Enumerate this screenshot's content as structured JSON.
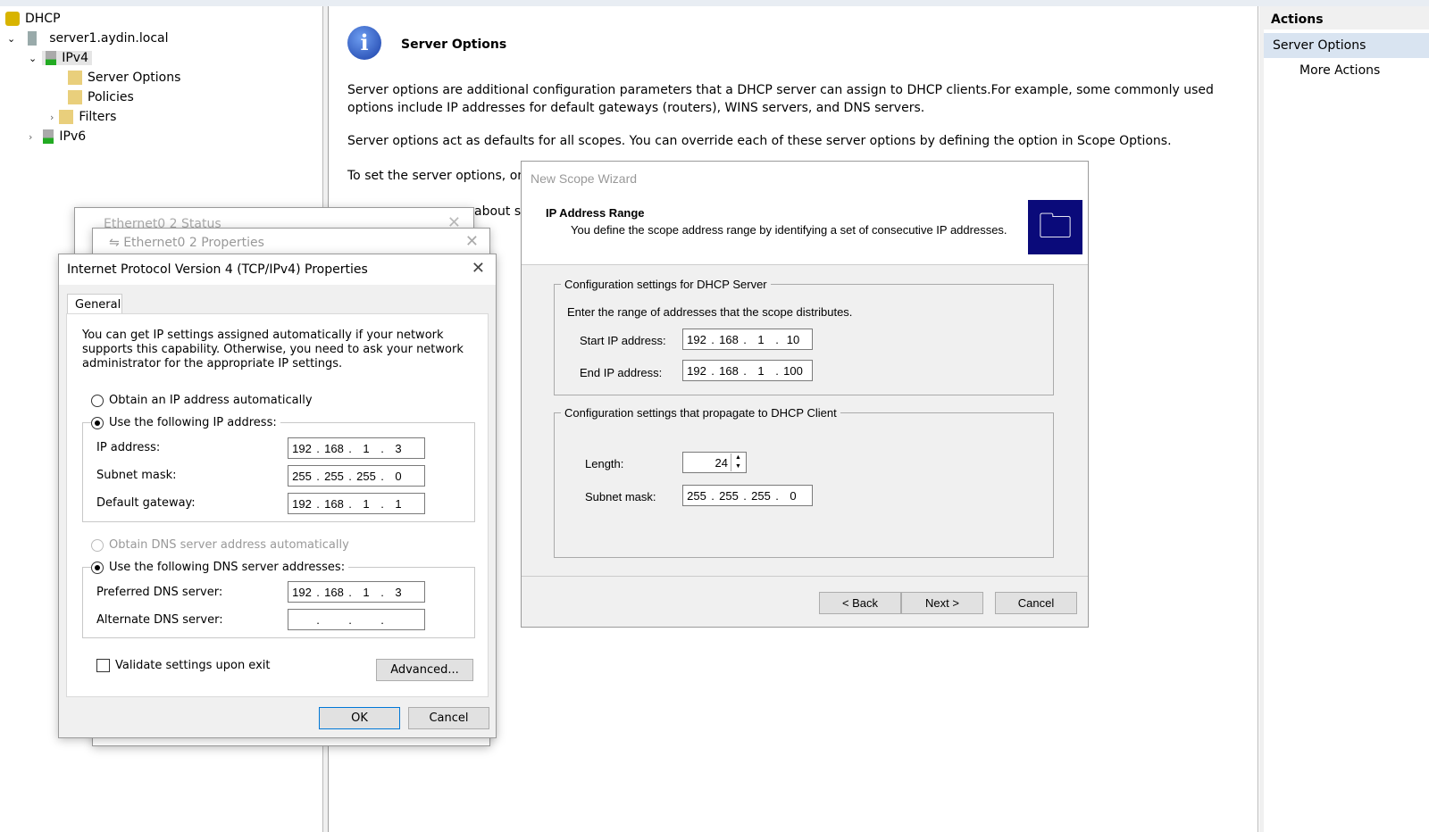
{
  "tree": {
    "items": [
      {
        "label": "DHCP",
        "icon": "dhcp-icon"
      },
      {
        "label": "server1.aydin.local",
        "icon": "server-icon"
      },
      {
        "label": "IPv4",
        "icon": "ipv4-icon"
      },
      {
        "label": "Server Options",
        "icon": "server-options-icon"
      },
      {
        "label": "Policies",
        "icon": "policies-icon"
      },
      {
        "label": "Filters",
        "icon": "filters-icon"
      },
      {
        "label": "IPv6",
        "icon": "ipv6-icon"
      }
    ]
  },
  "center": {
    "title": "Server Options",
    "p1": "Server options are additional configuration parameters that a DHCP server can assign to DHCP clients.For example, some commonly used options include IP addresses for default gateways (routers), WINS servers, and DNS servers.",
    "p2": "Server options act as defaults for all scopes.  You can override each of these server options by defining the option in Scope Options.",
    "p3": "To set the server options, on th",
    "p4": "about se"
  },
  "actions": {
    "title": "Actions",
    "selected": "Server Options",
    "more": "More Actions"
  },
  "eth_status": {
    "title": "Ethernet0 2 Status"
  },
  "eth_props": {
    "title": "Ethernet0 2 Properties"
  },
  "ipv4": {
    "title": "Internet Protocol Version 4 (TCP/IPv4) Properties",
    "tab": "General",
    "intro": "You can get IP settings assigned automatically if your network supports this capability. Otherwise, you need to ask your network administrator for the appropriate IP settings.",
    "auto_ip": "Obtain an IP address automatically",
    "use_ip": "Use the following IP address:",
    "ip_label": "IP address:",
    "ip": [
      "192",
      "168",
      "1",
      "3"
    ],
    "mask_label": "Subnet mask:",
    "mask": [
      "255",
      "255",
      "255",
      "0"
    ],
    "gw_label": "Default gateway:",
    "gw": [
      "192",
      "168",
      "1",
      "1"
    ],
    "auto_dns": "Obtain DNS server address automatically",
    "use_dns": "Use the following DNS server addresses:",
    "pdns_label": "Preferred DNS server:",
    "pdns": [
      "192",
      "168",
      "1",
      "3"
    ],
    "adns_label": "Alternate DNS server:",
    "adns": [
      "",
      "",
      "",
      ""
    ],
    "validate": "Validate settings upon exit",
    "advanced": "Advanced...",
    "ok": "OK",
    "cancel": "Cancel"
  },
  "wizard": {
    "title": "New Scope Wizard",
    "heading": "IP Address Range",
    "sub": "You define the scope address range by identifying a set of consecutive IP addresses.",
    "grp1": "Configuration settings for DHCP Server",
    "grp1_text": "Enter the range of addresses that the scope distributes.",
    "start_label": "Start IP address:",
    "start": [
      "192",
      "168",
      "1",
      "10"
    ],
    "end_label": "End IP address:",
    "end": [
      "192",
      "168",
      "1",
      "100"
    ],
    "grp2": "Configuration settings that propagate to DHCP Client",
    "length_label": "Length:",
    "length": "24",
    "mask_label": "Subnet mask:",
    "mask": [
      "255",
      "255",
      "255",
      "0"
    ],
    "back": "< Back",
    "next": "Next >",
    "cancel": "Cancel"
  }
}
